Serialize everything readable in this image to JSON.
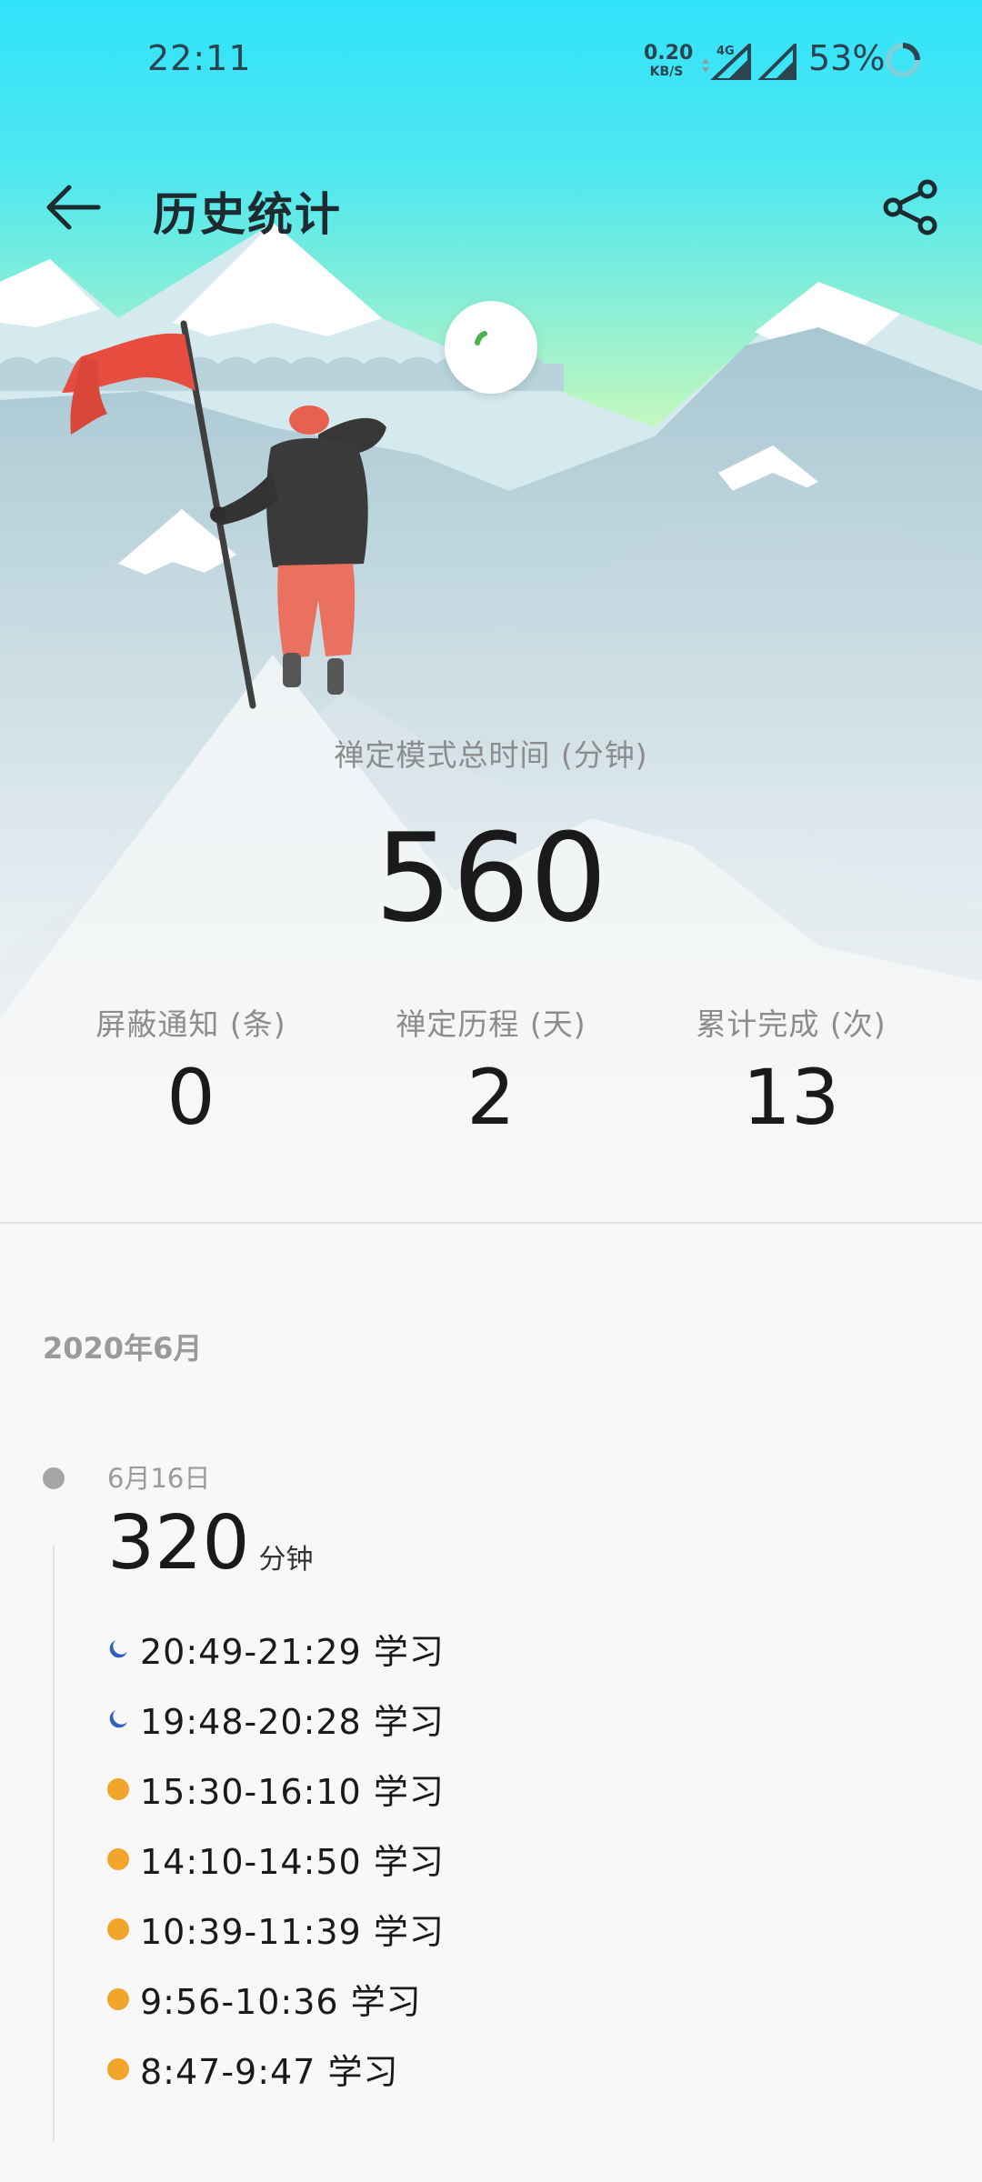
{
  "status_bar": {
    "time": "22:11",
    "net_speed_value": "0.20",
    "net_speed_unit": "KB/S",
    "network_type": "4G",
    "battery_percent": "53%"
  },
  "app_bar": {
    "title": "历史统计",
    "back_icon": "arrow-left-icon",
    "share_icon": "share-icon"
  },
  "summary": {
    "total_label": "禅定模式总时间 (分钟)",
    "total_value": "560",
    "stats": [
      {
        "label": "屏蔽通知 (条)",
        "value": "0"
      },
      {
        "label": "禅定历程 (天)",
        "value": "2"
      },
      {
        "label": "累计完成 (次)",
        "value": "13"
      }
    ]
  },
  "history": {
    "month_header": "2020年6月",
    "days": [
      {
        "date": "6月16日",
        "total": "320",
        "unit": "分钟",
        "sessions": [
          {
            "time": "20:49-21:29",
            "label": "学习",
            "icon": "moon-icon"
          },
          {
            "time": "19:48-20:28",
            "label": "学习",
            "icon": "moon-icon"
          },
          {
            "time": "15:30-16:10",
            "label": "学习",
            "icon": "sun-dot-icon"
          },
          {
            "time": "14:10-14:50",
            "label": "学习",
            "icon": "sun-dot-icon"
          },
          {
            "time": "10:39-11:39",
            "label": "学习",
            "icon": "sun-dot-icon"
          },
          {
            "time": "9:56-10:36",
            "label": "学习",
            "icon": "sun-dot-icon"
          },
          {
            "time": "8:47-9:47",
            "label": "学习",
            "icon": "sun-dot-icon"
          }
        ]
      }
    ]
  },
  "colors": {
    "sky_top": "#31e4fb",
    "sky_bottom": "#d8fbb6",
    "flag": "#ea5e4a",
    "moon": "#2f5fc4",
    "sun_dot": "#f1a52a",
    "mountain": "#b4cdd6"
  }
}
